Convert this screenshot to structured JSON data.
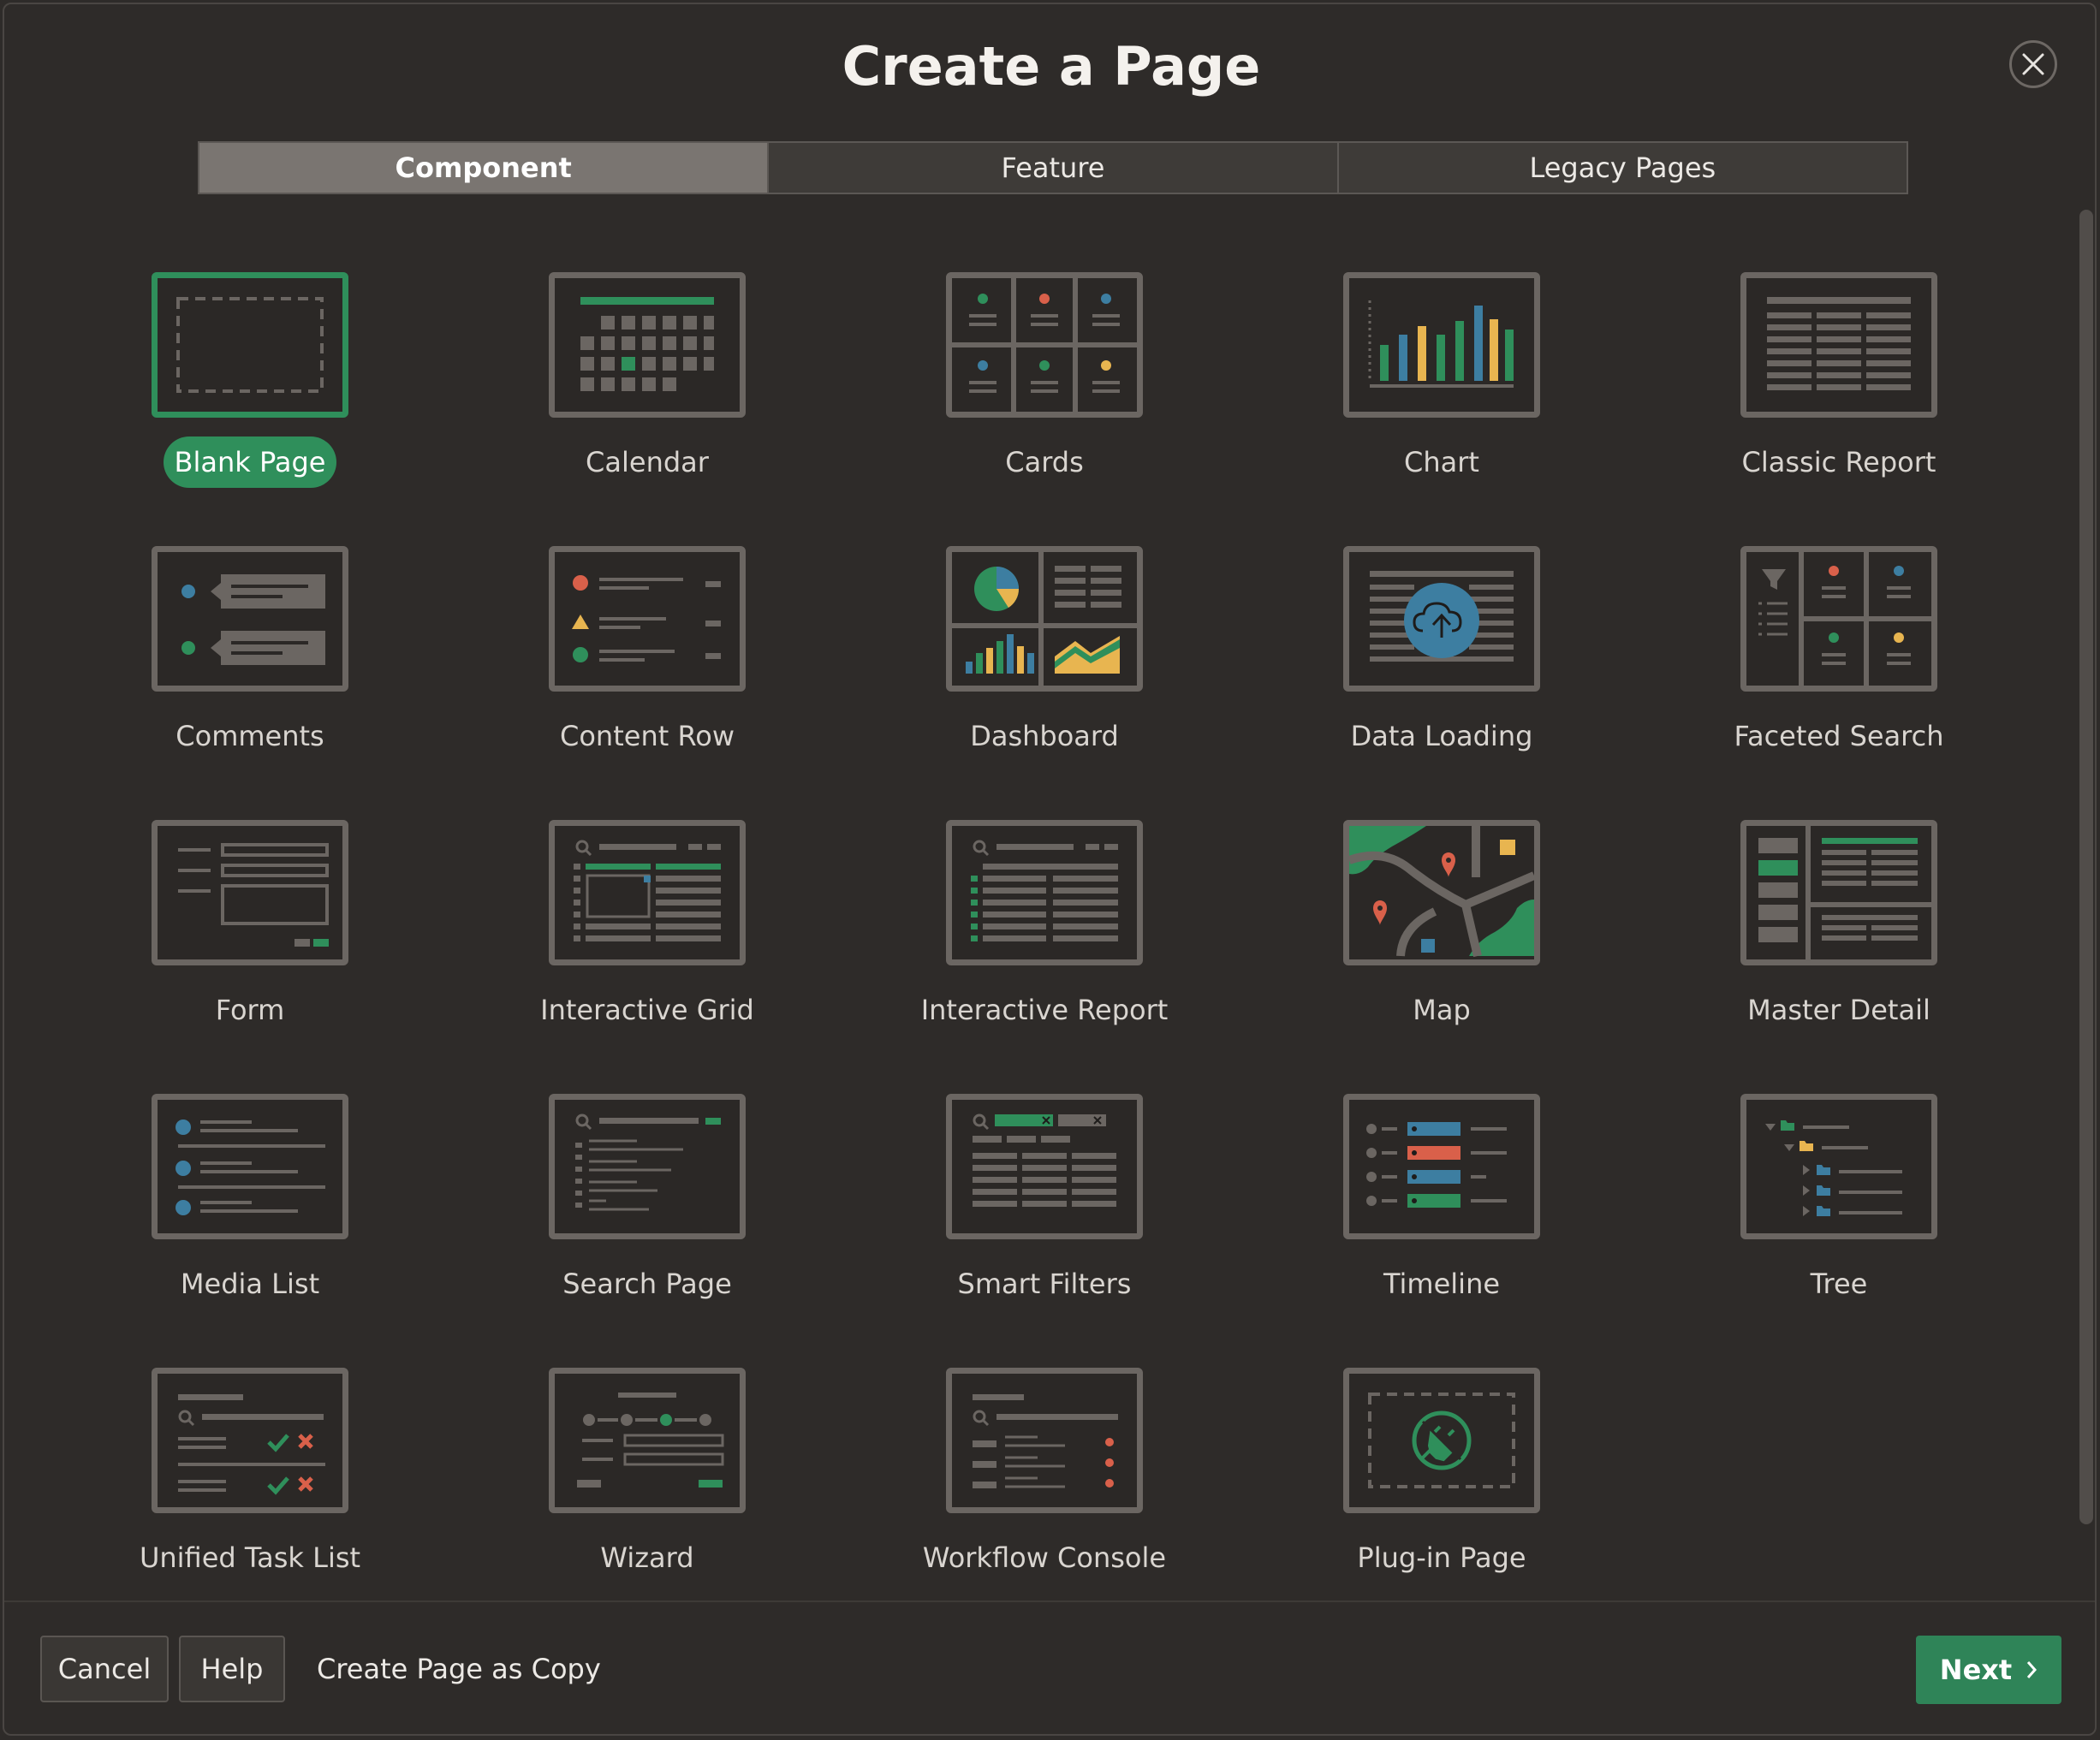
{
  "dialog": {
    "title": "Create a Page"
  },
  "tabs": [
    {
      "label": "Component",
      "active": true
    },
    {
      "label": "Feature",
      "active": false
    },
    {
      "label": "Legacy Pages",
      "active": false
    }
  ],
  "components": [
    {
      "label": "Blank Page",
      "icon": "blank-page-icon",
      "selected": true
    },
    {
      "label": "Calendar",
      "icon": "calendar-icon"
    },
    {
      "label": "Cards",
      "icon": "cards-icon"
    },
    {
      "label": "Chart",
      "icon": "chart-icon"
    },
    {
      "label": "Classic Report",
      "icon": "classic-report-icon"
    },
    {
      "label": "Comments",
      "icon": "comments-icon"
    },
    {
      "label": "Content Row",
      "icon": "content-row-icon"
    },
    {
      "label": "Dashboard",
      "icon": "dashboard-icon"
    },
    {
      "label": "Data Loading",
      "icon": "data-loading-icon"
    },
    {
      "label": "Faceted Search",
      "icon": "faceted-search-icon"
    },
    {
      "label": "Form",
      "icon": "form-icon"
    },
    {
      "label": "Interactive Grid",
      "icon": "interactive-grid-icon"
    },
    {
      "label": "Interactive Report",
      "icon": "interactive-report-icon"
    },
    {
      "label": "Map",
      "icon": "map-icon"
    },
    {
      "label": "Master Detail",
      "icon": "master-detail-icon"
    },
    {
      "label": "Media List",
      "icon": "media-list-icon"
    },
    {
      "label": "Search Page",
      "icon": "search-page-icon"
    },
    {
      "label": "Smart Filters",
      "icon": "smart-filters-icon"
    },
    {
      "label": "Timeline",
      "icon": "timeline-icon"
    },
    {
      "label": "Tree",
      "icon": "tree-icon"
    },
    {
      "label": "Unified Task List",
      "icon": "unified-task-list-icon"
    },
    {
      "label": "Wizard",
      "icon": "wizard-icon"
    },
    {
      "label": "Workflow Console",
      "icon": "workflow-console-icon"
    },
    {
      "label": "Plug-in Page",
      "icon": "plug-in-page-icon"
    }
  ],
  "footer": {
    "cancel_label": "Cancel",
    "help_label": "Help",
    "copy_label": "Create Page as Copy",
    "next_label": "Next"
  },
  "colors": {
    "accent": "#2f8f5b",
    "blue": "#3d7ea1",
    "red": "#d9604a",
    "yellow": "#e8b550"
  }
}
